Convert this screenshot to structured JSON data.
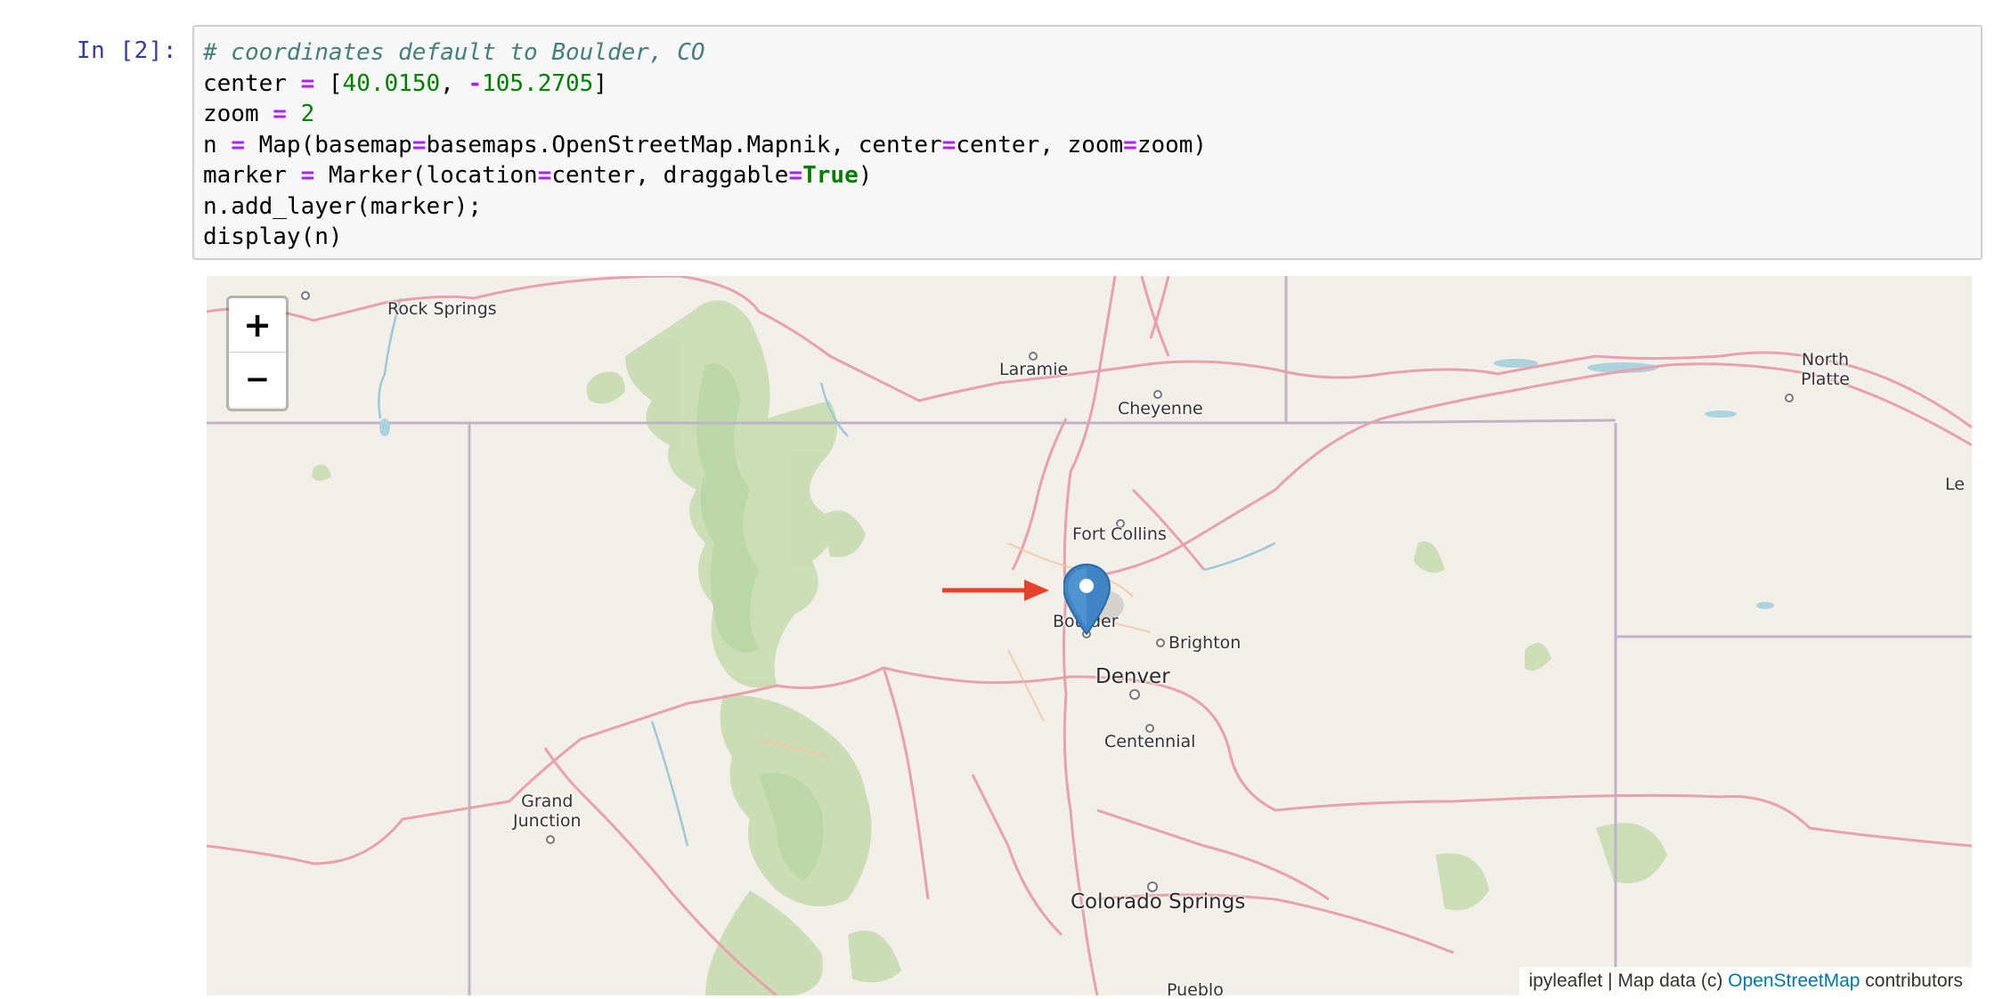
{
  "cell": {
    "prompt": "In [2]:",
    "code": {
      "comment": "# coordinates default to Boulder, CO",
      "line2": {
        "var": "center",
        "op": "=",
        "open": "[",
        "lat": "40.0150",
        "sep": ", ",
        "minus": "-",
        "lon": "105.2705",
        "close": "]"
      },
      "line3": {
        "var": "zoom",
        "op": "=",
        "val": "2"
      },
      "line4": {
        "a": "n ",
        "op1": "=",
        "b": " Map(basemap",
        "op2": "=",
        "c": "basemaps.OpenStreetMap.Mapnik, center",
        "op3": "=",
        "d": "center, zoom",
        "op4": "=",
        "e": "zoom)"
      },
      "line5": {
        "a": "marker ",
        "op1": "=",
        "b": " Marker(location",
        "op2": "=",
        "c": "center, draggable",
        "op3": "=",
        "kw": "True",
        "d": ")"
      },
      "line6": "n.add_layer(marker);",
      "line7": "display(n)"
    }
  },
  "map": {
    "zoom_in_label": "+",
    "zoom_out_label": "−",
    "cities": {
      "rock_springs": "Rock Springs",
      "laramie": "Laramie",
      "cheyenne": "Cheyenne",
      "north": "North",
      "platte": "Platte",
      "le": "Le",
      "fort_collins": "Fort Collins",
      "boulder": "Boulder",
      "brighton": "Brighton",
      "denver": "Denver",
      "centennial": "Centennial",
      "grand": "Grand",
      "junction": "Junction",
      "colorado_springs": "Colorado Springs",
      "pueblo": "Pueblo"
    },
    "marker_icon": "map-pin-icon",
    "annotation_arrow_color": "#e8412a",
    "attribution": {
      "prefix": "ipyleaflet | Map data (c) ",
      "link": "OpenStreetMap",
      "suffix": " contributors"
    }
  },
  "colors": {
    "forest": "#b5d29b",
    "road": "#e79aa6",
    "border": "#b9aec5",
    "water": "#aad3df",
    "marker": "#3f85c6"
  }
}
